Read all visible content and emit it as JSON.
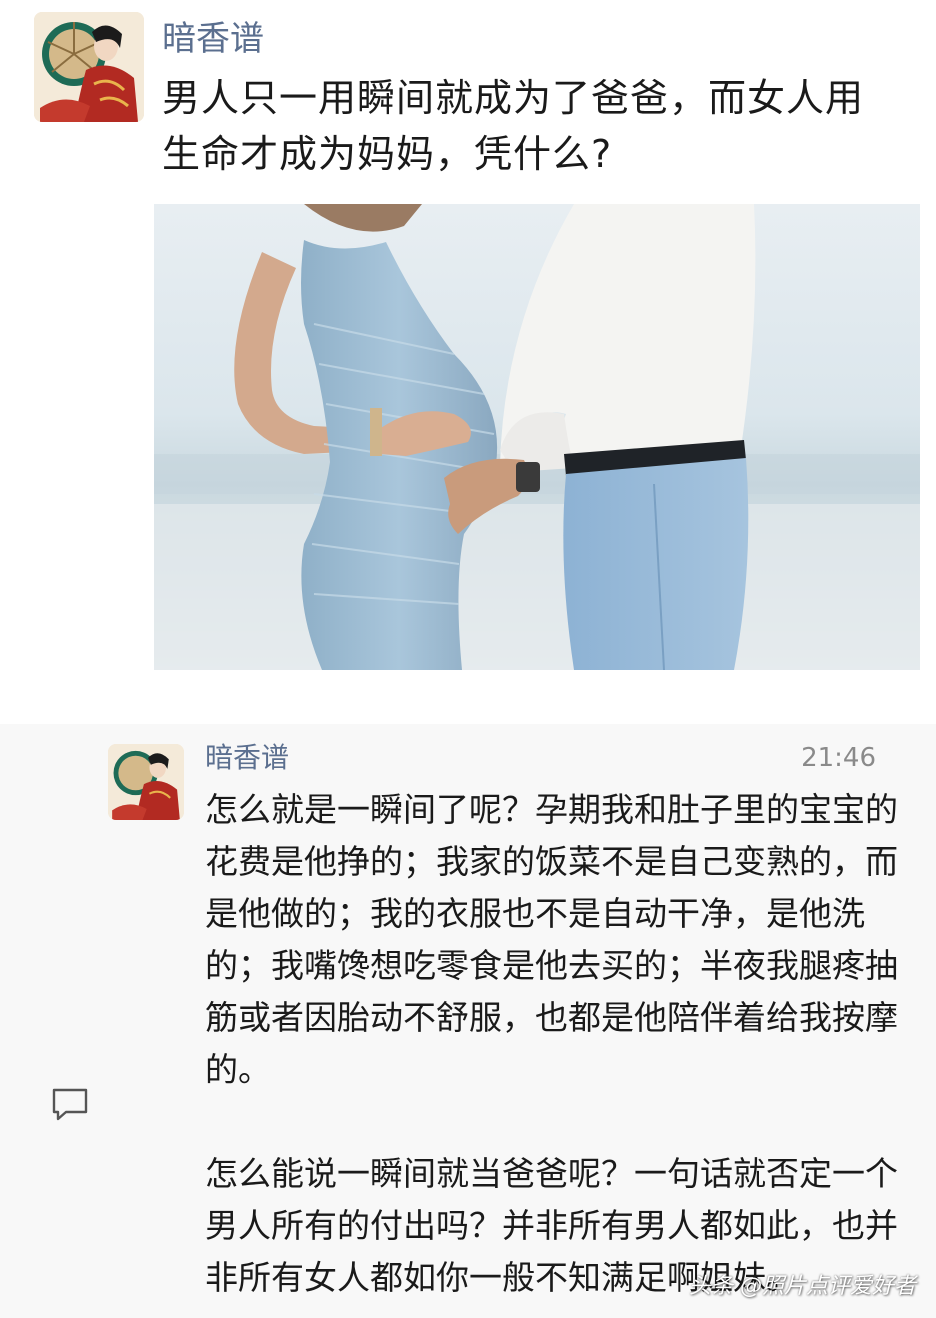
{
  "post": {
    "author": "暗香谱",
    "text": "男人只一用瞬间就成为了爸爸，而女人用生命才成为妈妈，凭什么?",
    "image_icon": "pregnant-couple-photo"
  },
  "comment": {
    "author": "暗香谱",
    "time": "21:46",
    "paragraphs": [
      "怎么就是一瞬间了呢？孕期我和肚子里的宝宝的花费是他挣的；我家的饭菜不是自己变熟的，而是他做的；我的衣服也不是自动干净，是他洗的；我嘴馋想吃零食是他去买的；半夜我腿疼抽筋或者因胎动不舒服，也都是他陪伴着给我按摩的。",
      "怎么能说一瞬间就当爸爸呢？一句话就否定一个男人所有的付出吗？并非所有男人都如此，也并非所有女人都如你一般不知满足啊姐妹。"
    ],
    "icon": "comment-bubble-icon"
  },
  "watermark": "头条 @照片点评爱好者",
  "colors": {
    "name": "#5b6f8f",
    "text": "#1a1a1a",
    "comment_bg": "#f8f8f8"
  }
}
